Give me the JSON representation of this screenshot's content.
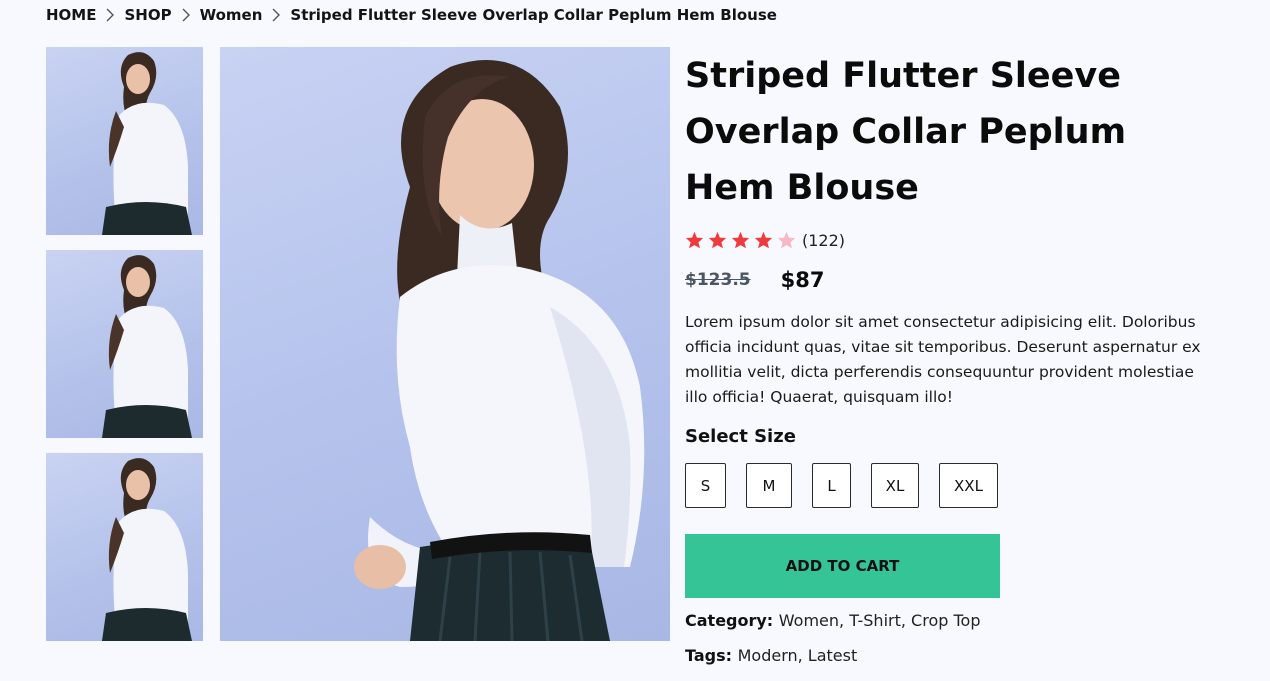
{
  "breadcrumb": {
    "items": [
      "HOME",
      "SHOP",
      "Women",
      "Striped Flutter Sleeve Overlap Collar Peplum Hem Blouse"
    ]
  },
  "product": {
    "title": "Striped Flutter Sleeve Overlap Collar Peplum Hem Blouse",
    "rating": 4.5,
    "rating_max": 5,
    "review_count": "(122)",
    "old_price": "$123.5",
    "price": "$87",
    "description": "Lorem ipsum dolor sit amet consectetur adipisicing elit. Doloribus officia incidunt quas, vitae sit temporibus. Deserunt aspernatur ex mollitia velit, dicta perferendis consequuntur provident molestiae illo officia! Quaerat, quisquam illo!",
    "select_size_label": "Select Size",
    "sizes": [
      "S",
      "M",
      "L",
      "XL",
      "XXL"
    ],
    "add_to_cart_label": "ADD TO CART",
    "category_label": "Category:",
    "category_values": "Women, T-Shirt, Crop Top",
    "tags_label": "Tags:",
    "tags_values": "Modern, Latest"
  },
  "colors": {
    "accent": "#34c496",
    "star_filled": "#ef3b3b",
    "star_empty": "#f5b8c4",
    "background": "#f8f9fe"
  }
}
